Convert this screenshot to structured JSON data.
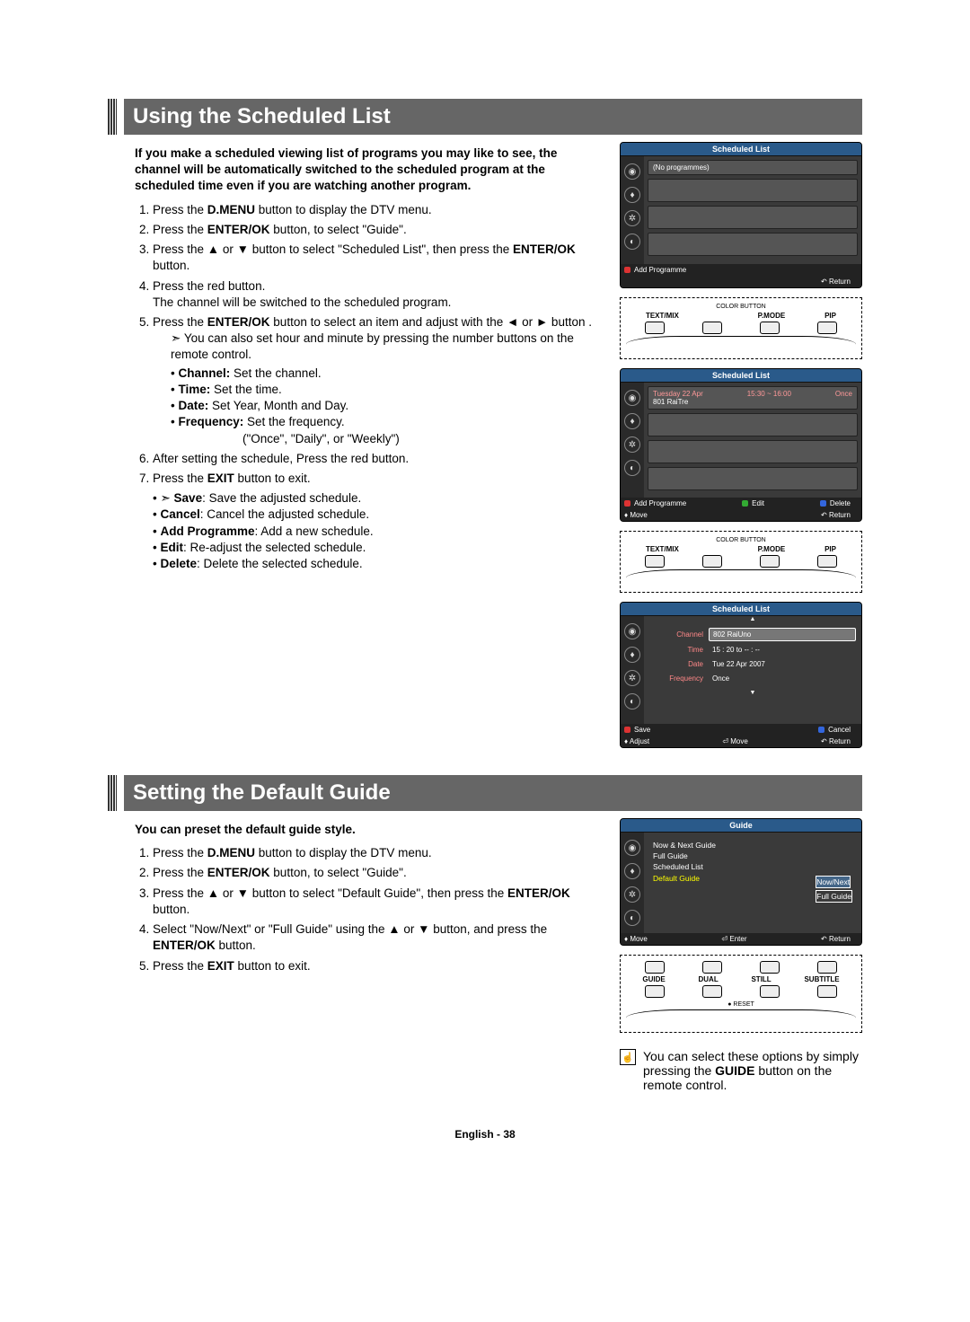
{
  "section1": {
    "title": "Using the Scheduled List",
    "intro": "If you make a scheduled viewing list of programs you may like to see, the channel will be automatically switched to the scheduled program at the scheduled time even if you are watching another program.",
    "step1_a": "Press the ",
    "step1_b": "D.MENU",
    "step1_c": " button to display the DTV menu.",
    "step2_a": "Press the ",
    "step2_b": "ENTER/OK",
    "step2_c": " button, to select \"Guide\".",
    "step3_a": "Press the ▲ or ▼ button to select \"Scheduled List\", then press the ",
    "step3_b": "ENTER/OK",
    "step3_c": " button.",
    "step4_a": "Press the red button.",
    "step4_b": "The channel will be switched to the scheduled program.",
    "step5_a": "Press the ",
    "step5_b": "ENTER/OK",
    "step5_c": " button to select an item and adjust with the ◄ or ► button .",
    "step5_note": "You can also set hour and minute by pressing the number buttons on the remote control.",
    "step5_ch_a": "Channel:",
    "step5_ch_b": " Set the channel.",
    "step5_ti_a": "Time:",
    "step5_ti_b": " Set the time.",
    "step5_da_a": "Date:",
    "step5_da_b": " Set Year, Month and Day.",
    "step5_fr_a": "Frequency:",
    "step5_fr_b": " Set the frequency.",
    "step5_fr_opts": "(\"Once\", \"Daily\", or \"Weekly\")",
    "step6": "After setting the schedule, Press the red button.",
    "step7_a": "Press the ",
    "step7_b": "EXIT",
    "step7_c": " button to exit.",
    "end_save_a": "Save",
    "end_save_b": ": Save the adjusted schedule.",
    "end_cancel_a": "Cancel",
    "end_cancel_b": ": Cancel the adjusted schedule.",
    "end_add_a": "Add Programme",
    "end_add_b": ": Add a new schedule.",
    "end_edit_a": "Edit",
    "end_edit_b": ": Re-adjust the selected schedule.",
    "end_del_a": "Delete",
    "end_del_b": ": Delete the selected schedule."
  },
  "section2": {
    "title": "Setting the Default Guide",
    "intro": "You can preset the default guide style.",
    "step1_a": "Press the ",
    "step1_b": "D.MENU",
    "step1_c": " button to display the DTV menu.",
    "step2_a": "Press the ",
    "step2_b": "ENTER/OK",
    "step2_c": " button, to select \"Guide\".",
    "step3_a": "Press the ▲ or ▼ button to select \"Default Guide\", then press the ",
    "step3_b": "ENTER/OK",
    "step3_c": " button.",
    "step4_a": "Select \"Now/Next\" or \"Full Guide\" using the ▲ or ▼ button, and press the ",
    "step4_b": "ENTER/OK",
    "step4_c": " button.",
    "step5_a": "Press the ",
    "step5_b": "EXIT",
    "step5_c": " button to exit.",
    "tip_a": "You can select these options by simply pressing the ",
    "tip_b": "GUIDE",
    "tip_c": " button on the remote control."
  },
  "osd1": {
    "header": "Scheduled List",
    "noprog": "(No programmes)",
    "add": "Add Programme",
    "return": "Return"
  },
  "remote1": {
    "title": "COLOR BUTTON",
    "l1": "TEXT/MIX",
    "l2": "",
    "l3": "P.MODE",
    "l4": "PIP"
  },
  "osd2": {
    "header": "Scheduled List",
    "date": "Tuesday 22 Apr",
    "time": "15:30 ~ 16:00",
    "freq": "Once",
    "chan": "801 RaiTre",
    "add": "Add Programme",
    "edit": "Edit",
    "delete": "Delete",
    "move": "Move",
    "return": "Return"
  },
  "osd3": {
    "header": "Scheduled List",
    "ch_lbl": "Channel",
    "ch_val": "802 RaiUno",
    "ti_lbl": "Time",
    "ti_val": "15 : 20 to -- : --",
    "da_lbl": "Date",
    "da_val": "Tue 22 Apr 2007",
    "fr_lbl": "Frequency",
    "fr_val": "Once",
    "save": "Save",
    "cancel": "Cancel",
    "adjust": "Adjust",
    "move": "Move",
    "return": "Return"
  },
  "osd4": {
    "header": "Guide",
    "item1": "Now & Next Guide",
    "item2": "Full Guide",
    "item3": "Scheduled List",
    "item4": "Default Guide",
    "opt1": "Now/Next",
    "opt2": "Full Guide",
    "move": "Move",
    "enter": "Enter",
    "return": "Return"
  },
  "remote2": {
    "l1": "GUIDE",
    "l2": "DUAL",
    "l3": "STILL",
    "l4": "SUBTITLE",
    "reset": "RESET"
  },
  "footer": "English - 38"
}
